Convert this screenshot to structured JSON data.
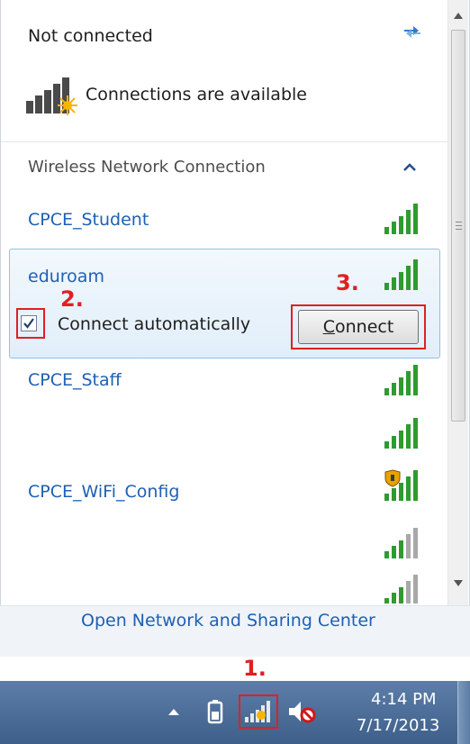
{
  "status": {
    "title": "Not connected",
    "availability": "Connections are available"
  },
  "section": {
    "label": "Wireless Network Connection"
  },
  "networks": [
    {
      "name": "CPCE_Student",
      "signal_bars": 5,
      "secured": false
    },
    {
      "name": "eduroam",
      "signal_bars": 5,
      "secured": false,
      "selected": true
    },
    {
      "name": "CPCE_Staff",
      "signal_bars": 5,
      "secured": false
    },
    {
      "name": "",
      "signal_bars": 5,
      "secured": false
    },
    {
      "name": "CPCE_WiFi_Config",
      "signal_bars": 5,
      "secured": true
    },
    {
      "name": "",
      "signal_bars": 3,
      "secured": false
    },
    {
      "name": "",
      "signal_bars": 3,
      "secured": false
    }
  ],
  "selected_network": {
    "auto_connect_label": "Connect automatically",
    "auto_connect_checked": true,
    "connect_button": {
      "first": "C",
      "rest": "onnect"
    }
  },
  "footer": {
    "link": "Open Network and Sharing Center"
  },
  "steps": {
    "one": "1.",
    "two": "2.",
    "three": "3."
  },
  "taskbar": {
    "time": "4:14 PM",
    "date": "7/17/2013"
  },
  "colors": {
    "link_blue": "#1e5fb3",
    "signal_green": "#2e9b2e",
    "annotation_red": "#e02020",
    "taskbar_blue": "#4a6c96"
  }
}
